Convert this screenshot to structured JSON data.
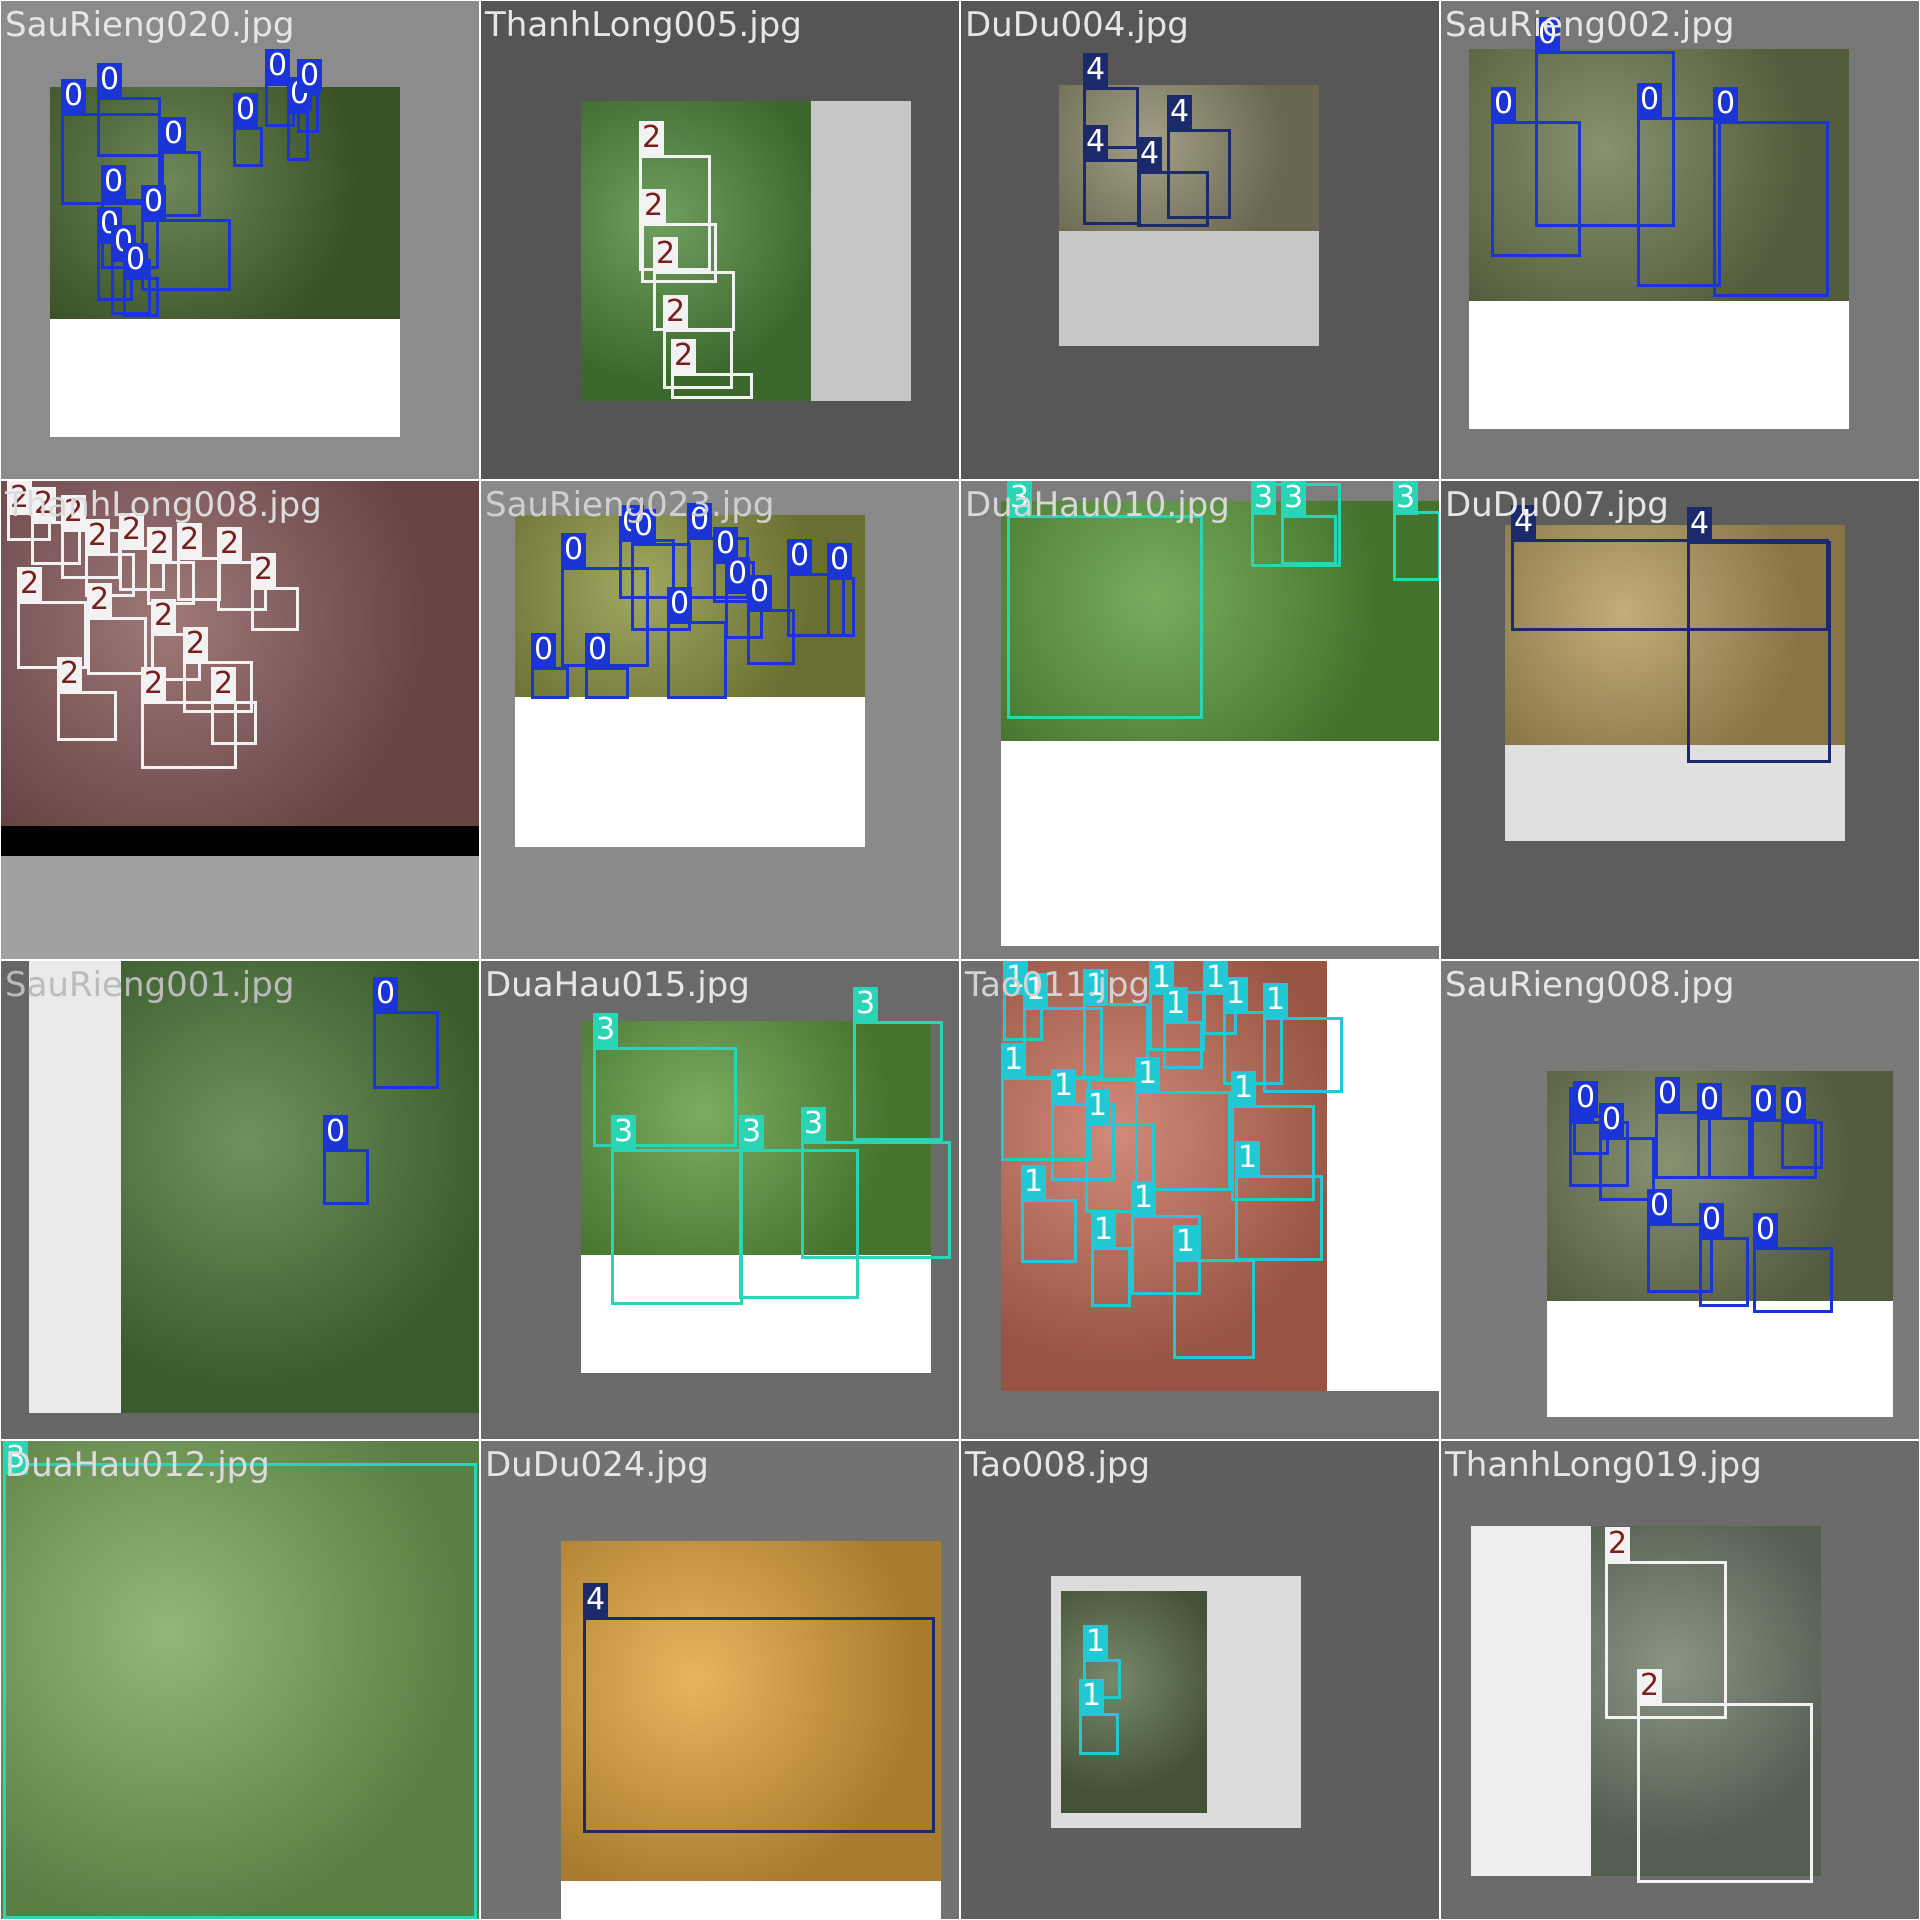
{
  "mosaic_title": "",
  "classes": {
    "0": {
      "color": "#1a34d6"
    },
    "1": {
      "color": "#22c9d4"
    },
    "2": {
      "color": "#f2f2f2"
    },
    "3": {
      "color": "#28d5b4"
    },
    "4": {
      "color": "#1b2a6b"
    }
  },
  "tiles": [
    {
      "file": "SauRieng020.jpg",
      "bg": "#8c8c8c",
      "photo_tone": "#4d6b34",
      "pad_tone": "#ffffff",
      "boxes": [
        {
          "label": "0",
          "cls": "0"
        },
        {
          "label": "0",
          "cls": "0"
        },
        {
          "label": "0",
          "cls": "0"
        },
        {
          "label": "0",
          "cls": "0"
        },
        {
          "label": "0",
          "cls": "0"
        },
        {
          "label": "0",
          "cls": "0"
        },
        {
          "label": "0",
          "cls": "0"
        },
        {
          "label": "0",
          "cls": "0"
        },
        {
          "label": "0",
          "cls": "0"
        },
        {
          "label": "0",
          "cls": "0"
        },
        {
          "label": "0",
          "cls": "0"
        },
        {
          "label": "0",
          "cls": "0"
        }
      ]
    },
    {
      "file": "ThanhLong005.jpg",
      "bg": "#555555",
      "photo_tone": "#4f8a3c",
      "pad_tone": "#c6c6c6",
      "boxes": [
        {
          "label": "2",
          "cls": "2"
        },
        {
          "label": "2",
          "cls": "2"
        },
        {
          "label": "2",
          "cls": "2"
        },
        {
          "label": "2",
          "cls": "2"
        },
        {
          "label": "2",
          "cls": "2"
        }
      ]
    },
    {
      "file": "DuDu004.jpg",
      "bg": "#575757",
      "photo_tone": "#8e8a6c",
      "pad_tone": "#c8c8c8",
      "boxes": [
        {
          "label": "4",
          "cls": "4"
        },
        {
          "label": "4",
          "cls": "4"
        },
        {
          "label": "4",
          "cls": "4"
        },
        {
          "label": "4",
          "cls": "4"
        }
      ]
    },
    {
      "file": "SauRieng002.jpg",
      "bg": "#777777",
      "photo_tone": "#6e7a4f",
      "pad_tone": "#ffffff",
      "boxes": [
        {
          "label": "0",
          "cls": "0"
        },
        {
          "label": "0",
          "cls": "0"
        },
        {
          "label": "0",
          "cls": "0"
        },
        {
          "label": "0",
          "cls": "0"
        }
      ]
    },
    {
      "file": "ThanhLong008.jpg",
      "bg": "#a0a0a0",
      "photo_tone": "#8a5a5a",
      "pad_tone": "#000000",
      "boxes": [
        {
          "label": "2",
          "cls": "2"
        },
        {
          "label": "2",
          "cls": "2"
        },
        {
          "label": "2",
          "cls": "2"
        },
        {
          "label": "2",
          "cls": "2"
        },
        {
          "label": "2",
          "cls": "2"
        },
        {
          "label": "2",
          "cls": "2"
        },
        {
          "label": "2",
          "cls": "2"
        },
        {
          "label": "2",
          "cls": "2"
        },
        {
          "label": "2",
          "cls": "2"
        },
        {
          "label": "2",
          "cls": "2"
        },
        {
          "label": "2",
          "cls": "2"
        },
        {
          "label": "2",
          "cls": "2"
        },
        {
          "label": "2",
          "cls": "2"
        },
        {
          "label": "2",
          "cls": "2"
        },
        {
          "label": "2",
          "cls": "2"
        },
        {
          "label": "2",
          "cls": "2"
        }
      ]
    },
    {
      "file": "SauRieng023.jpg",
      "bg": "#8a8a8a",
      "photo_tone": "#8b9440",
      "pad_tone": "#ffffff",
      "boxes": [
        {
          "label": "0",
          "cls": "0"
        },
        {
          "label": "0",
          "cls": "0"
        },
        {
          "label": "0",
          "cls": "0"
        },
        {
          "label": "0",
          "cls": "0"
        },
        {
          "label": "0",
          "cls": "0"
        },
        {
          "label": "0",
          "cls": "0"
        },
        {
          "label": "0",
          "cls": "0"
        },
        {
          "label": "0",
          "cls": "0"
        },
        {
          "label": "0",
          "cls": "0"
        },
        {
          "label": "0",
          "cls": "0"
        },
        {
          "label": "0",
          "cls": "0"
        },
        {
          "label": "0",
          "cls": "0"
        }
      ]
    },
    {
      "file": "DuaHau010.jpg",
      "bg": "#7d7d7d",
      "photo_tone": "#5a9a3a",
      "pad_tone": "#ffffff",
      "boxes": [
        {
          "label": "3",
          "cls": "3"
        },
        {
          "label": "3",
          "cls": "3"
        },
        {
          "label": "3",
          "cls": "3"
        },
        {
          "label": "3",
          "cls": "3"
        }
      ]
    },
    {
      "file": "DuDu007.jpg",
      "bg": "#5d5d5d",
      "photo_tone": "#b59a5c",
      "pad_tone": "#e0e0e0",
      "boxes": [
        {
          "label": "4",
          "cls": "4"
        },
        {
          "label": "4",
          "cls": "4"
        }
      ]
    },
    {
      "file": "SauRieng001.jpg",
      "bg": "#666666",
      "photo_tone": "#4e7a3a",
      "pad_tone": "#eaeaea",
      "boxes": [
        {
          "label": "0",
          "cls": "0"
        },
        {
          "label": "0",
          "cls": "0"
        }
      ]
    },
    {
      "file": "DuaHau015.jpg",
      "bg": "#6a6a6a",
      "photo_tone": "#5e9a3e",
      "pad_tone": "#ffffff",
      "boxes": [
        {
          "label": "3",
          "cls": "3"
        },
        {
          "label": "3",
          "cls": "3"
        },
        {
          "label": "3",
          "cls": "3"
        },
        {
          "label": "3",
          "cls": "3"
        },
        {
          "label": "3",
          "cls": "3"
        }
      ]
    },
    {
      "file": "Tao011.jpg",
      "bg": "#6f6f6f",
      "photo_tone": "#c9705a",
      "pad_tone": "#ffffff",
      "boxes": [
        {
          "label": "1",
          "cls": "1"
        },
        {
          "label": "1",
          "cls": "1"
        },
        {
          "label": "1",
          "cls": "1"
        },
        {
          "label": "1",
          "cls": "1"
        },
        {
          "label": "1",
          "cls": "1"
        },
        {
          "label": "1",
          "cls": "1"
        },
        {
          "label": "1",
          "cls": "1"
        },
        {
          "label": "1",
          "cls": "1"
        },
        {
          "label": "1",
          "cls": "1"
        },
        {
          "label": "1",
          "cls": "1"
        },
        {
          "label": "1",
          "cls": "1"
        },
        {
          "label": "1",
          "cls": "1"
        },
        {
          "label": "1",
          "cls": "1"
        },
        {
          "label": "1",
          "cls": "1"
        },
        {
          "label": "1",
          "cls": "1"
        },
        {
          "label": "1",
          "cls": "1"
        },
        {
          "label": "1",
          "cls": "1"
        },
        {
          "label": "1",
          "cls": "1"
        }
      ]
    },
    {
      "file": "SauRieng008.jpg",
      "bg": "#7a7a7a",
      "photo_tone": "#6d7a52",
      "pad_tone": "#ffffff",
      "boxes": [
        {
          "label": "0",
          "cls": "0"
        },
        {
          "label": "0",
          "cls": "0"
        },
        {
          "label": "0",
          "cls": "0"
        },
        {
          "label": "0",
          "cls": "0"
        },
        {
          "label": "0",
          "cls": "0"
        },
        {
          "label": "0",
          "cls": "0"
        },
        {
          "label": "0",
          "cls": "0"
        },
        {
          "label": "0",
          "cls": "0"
        },
        {
          "label": "0",
          "cls": "0"
        },
        {
          "label": "0",
          "cls": "0"
        }
      ]
    },
    {
      "file": "DuaHau012.jpg",
      "bg": "#ffffff",
      "photo_tone": "#79a85a",
      "pad_tone": "#ffffff",
      "boxes": [
        {
          "label": "3",
          "cls": "3"
        }
      ]
    },
    {
      "file": "DuDu024.jpg",
      "bg": "#727272",
      "photo_tone": "#e2a53c",
      "pad_tone": "#ffffff",
      "boxes": [
        {
          "label": "4",
          "cls": "4"
        }
      ]
    },
    {
      "file": "Tao008.jpg",
      "bg": "#5f5f5f",
      "photo_tone": "#5a6e4a",
      "pad_tone": "#dcdcdc",
      "boxes": [
        {
          "label": "1",
          "cls": "1"
        },
        {
          "label": "1",
          "cls": "1"
        }
      ]
    },
    {
      "file": "ThanhLong019.jpg",
      "bg": "#6b6b6b",
      "photo_tone": "#6f7d6a",
      "pad_tone": "#eeeeee",
      "boxes": [
        {
          "label": "2",
          "cls": "2"
        },
        {
          "label": "2",
          "cls": "2"
        }
      ]
    }
  ]
}
